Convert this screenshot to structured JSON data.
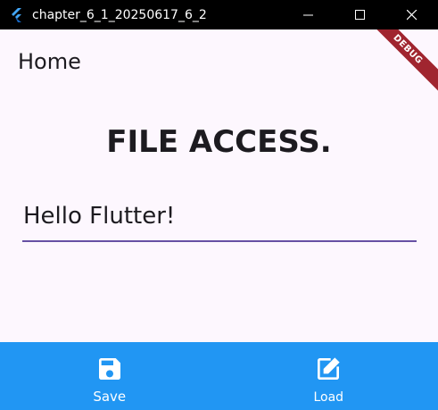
{
  "window": {
    "title": "chapter_6_1_20250617_6_2",
    "icon": "flutter-logo-icon",
    "controls": [
      "minimize-icon",
      "maximize-icon",
      "close-icon"
    ]
  },
  "appbar": {
    "title": "Home"
  },
  "debug_banner": "DEBUG",
  "main": {
    "heading": "FILE ACCESS.",
    "text_field_value": "Hello Flutter!"
  },
  "bottom_nav": {
    "items": [
      {
        "label": "Save",
        "icon": "save-icon"
      },
      {
        "label": "Load",
        "icon": "edit-open-icon"
      }
    ]
  },
  "colors": {
    "titlebar": "#000000",
    "background": "#fdf7fe",
    "underline": "#6750a4",
    "bottom_bar": "#2196f3",
    "debug_banner": "#a0252f"
  }
}
